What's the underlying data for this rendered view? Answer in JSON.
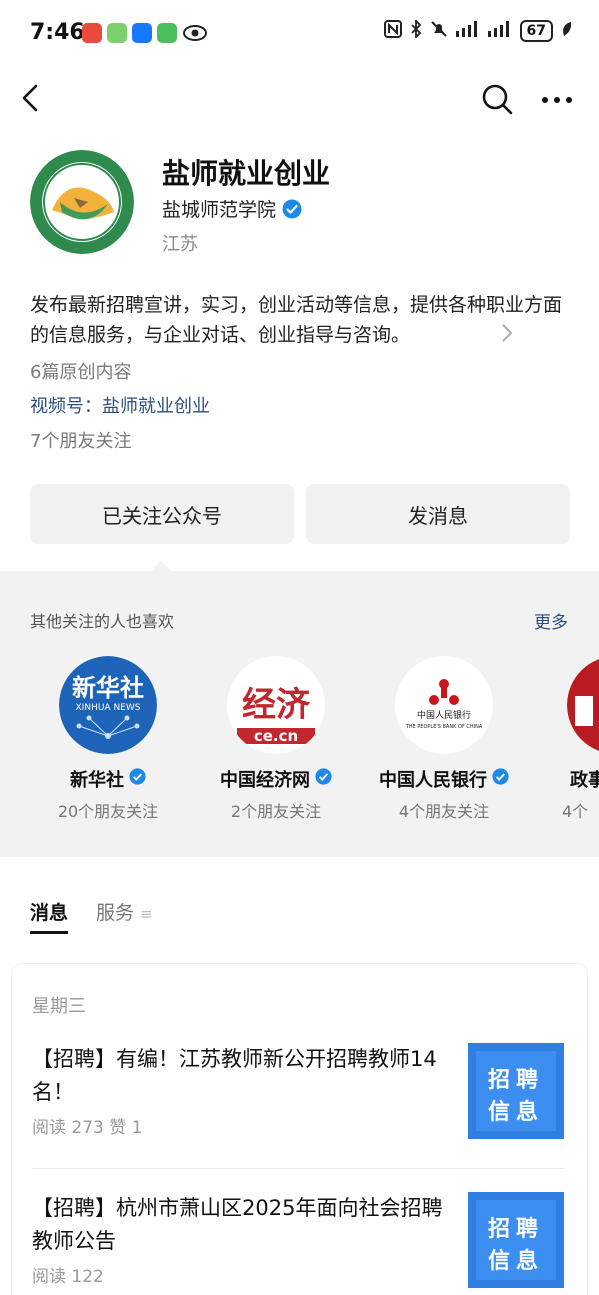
{
  "status": {
    "time": "7:46",
    "battery": "67"
  },
  "profile": {
    "name": "盐师就业创业",
    "org": "盐城师范学院",
    "region": "江苏",
    "description": "发布最新招聘宣讲，实习，创业活动等信息，提供各种职业方面的信息服务，与企业对话、创业指导与咨询。",
    "original_count": "6篇原创内容",
    "channel_label": "视频号：",
    "channel_name": "盐师就业创业",
    "friends_follow": "7个朋友关注"
  },
  "buttons": {
    "follow": "已关注公众号",
    "message": "发消息"
  },
  "recommend": {
    "title": "其他关注的人也喜欢",
    "more": "更多",
    "items": [
      {
        "name": "新华社",
        "sub": "20个朋友关注",
        "logo_text": "新华社",
        "logo_sub": "XINHUA NEWS"
      },
      {
        "name": "中国经济网",
        "sub": "2个朋友关注",
        "logo_text": "经济",
        "logo_sub": "ce.cn"
      },
      {
        "name": "中国人民银行",
        "sub": "4个朋友关注",
        "logo_text": "中国人民银行",
        "logo_sub": "THE PEOPLE'S BANK OF CHINA"
      },
      {
        "name": "政事",
        "sub": "4个"
      }
    ]
  },
  "tabs": [
    {
      "label": "消息"
    },
    {
      "label": "服务"
    }
  ],
  "messages": {
    "date": "星期三",
    "articles": [
      {
        "title": "【招聘】有编！江苏教师新公开招聘教师14名！",
        "meta": "阅读 273  赞 1",
        "thumb_l1": "招聘",
        "thumb_l2": "信息"
      },
      {
        "title": "【招聘】杭州市萧山区2025年面向社会招聘教师公告",
        "meta": "阅读 122",
        "thumb_l1": "招聘",
        "thumb_l2": "信息"
      }
    ]
  },
  "colors": {
    "accent_blue": "#2a4e83",
    "verified_blue": "#1e8ae8",
    "panel_gray": "#f2f2f2"
  }
}
